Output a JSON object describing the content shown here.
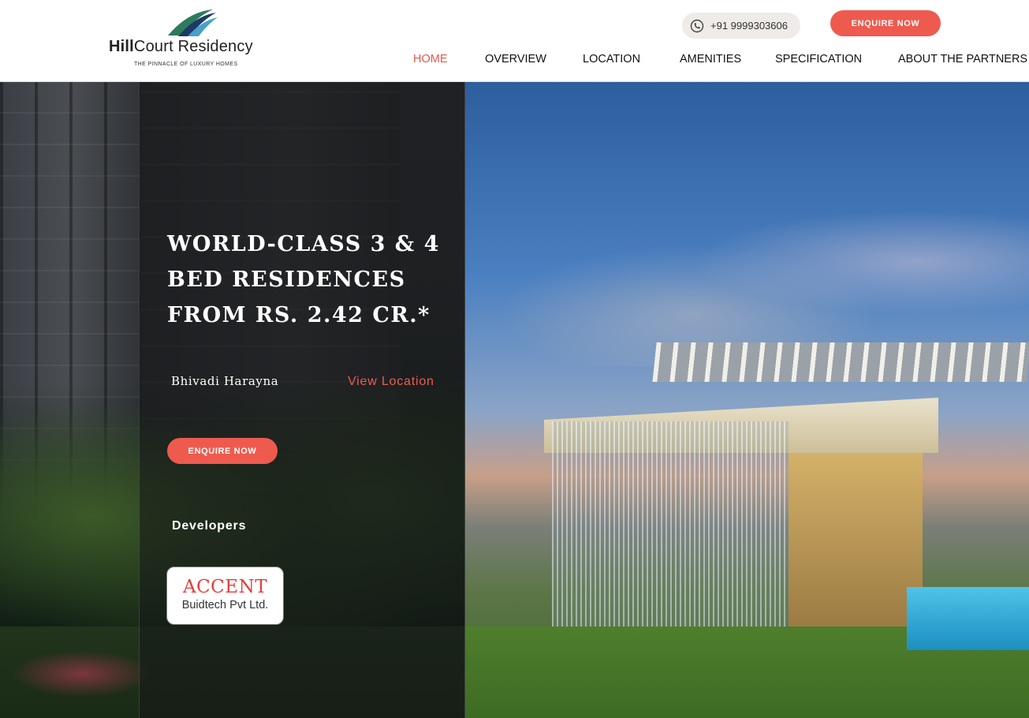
{
  "header": {
    "logo": {
      "title_bold": "Hill",
      "title_rest": "Court Residency",
      "tagline": "THE PINNACLE OF LUXURY HOMES"
    },
    "phone": {
      "icon": "phone-icon",
      "number": "+91 9999303606"
    },
    "enquire_label": "ENQUIRE NOW"
  },
  "nav": {
    "items": [
      {
        "label": "HOME",
        "active": true
      },
      {
        "label": "OVERVIEW",
        "active": false
      },
      {
        "label": "LOCATION",
        "active": false
      },
      {
        "label": "AMENITIES",
        "active": false
      },
      {
        "label": "SPECIFICATION",
        "active": false
      },
      {
        "label": "ABOUT THE PARTNERS",
        "active": false
      }
    ]
  },
  "hero": {
    "headline": "WORLD-CLASS 3 & 4 BED RESIDENCES FROM RS. 2.42 CR.*",
    "location": "Bhivadi Harayna",
    "view_location_label": "View Location",
    "enquire_label": "ENQUIRE NOW",
    "developers_label": "Developers",
    "developer": {
      "brand": "ACCENT",
      "name": "Buidtech Pvt Ltd."
    }
  },
  "colors": {
    "accent": "#ee5a4e",
    "nav_active": "#e8574b",
    "developer_brand": "#e83b3b"
  }
}
